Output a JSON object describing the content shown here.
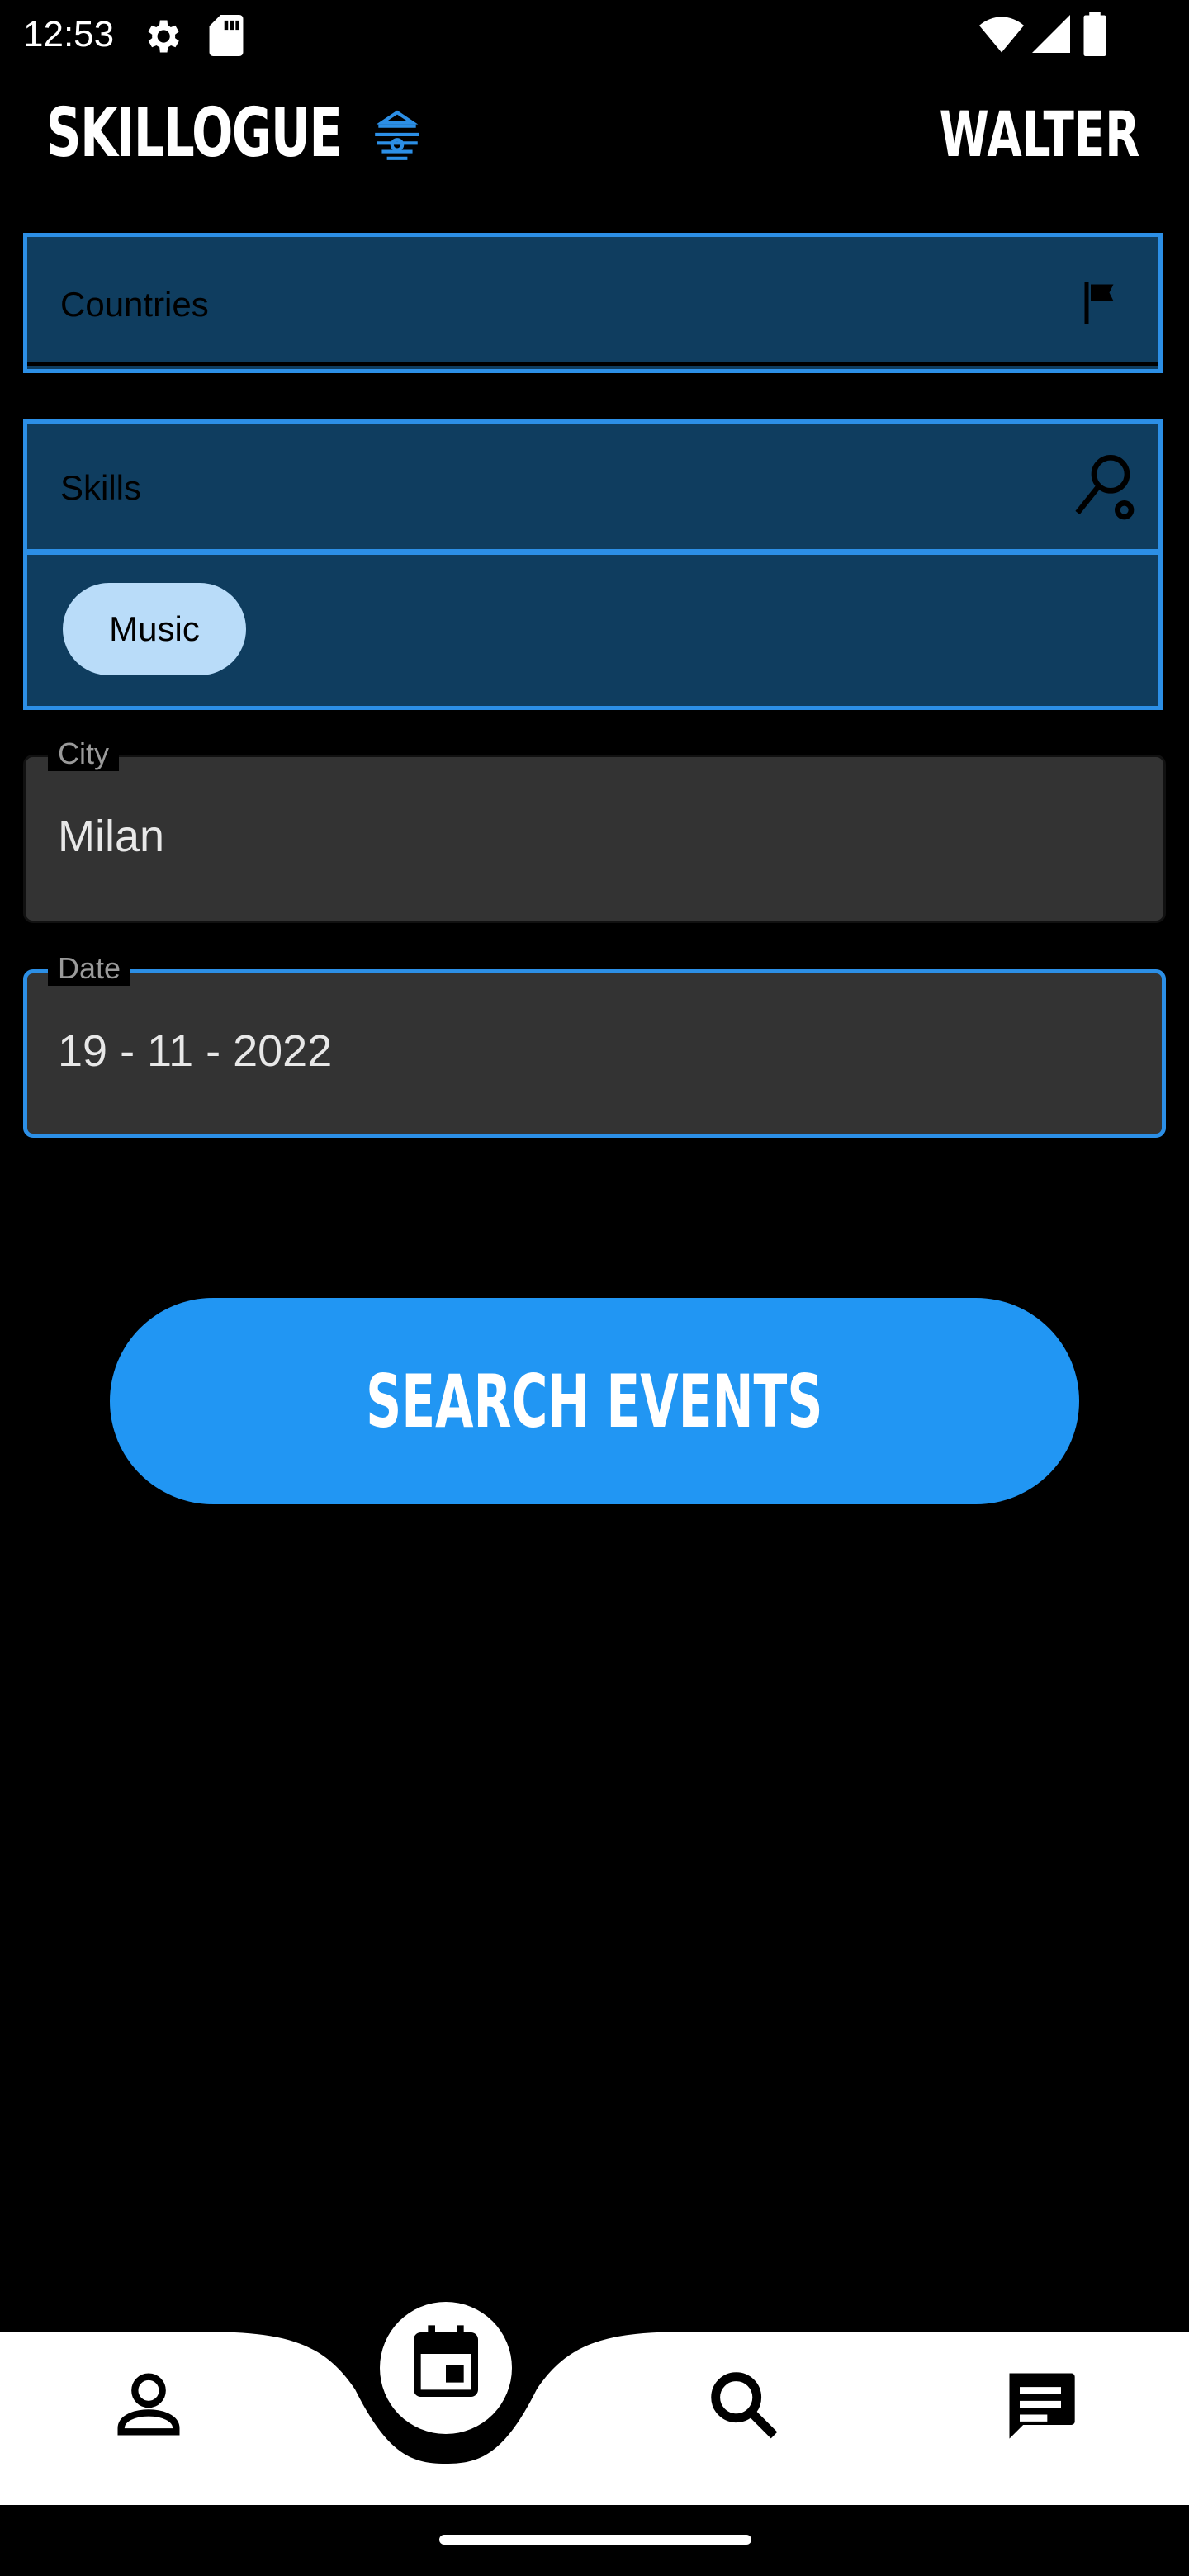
{
  "status_bar": {
    "time": "12:53",
    "icons": [
      "settings-icon",
      "sd-card-icon",
      "wifi-icon",
      "signal-icon",
      "battery-icon"
    ]
  },
  "header": {
    "app_title": "SKILLOGUE",
    "logo_icon": "beehive-icon",
    "user_name": "WALTER"
  },
  "filters": {
    "countries_label": "Countries",
    "countries_icon": "flag-icon",
    "skills_label": "Skills",
    "skills_icon": "key-search-icon",
    "skill_chips": [
      "Music"
    ]
  },
  "fields": {
    "city_label": "City",
    "city_value": "Milan",
    "date_label": "Date",
    "date_value": "19 - 11 - 2022"
  },
  "actions": {
    "search_label": "SEARCH EVENTS"
  },
  "bottom_nav": {
    "items": [
      "profile-icon",
      "calendar-icon",
      "search-icon",
      "chat-icon"
    ],
    "active": "calendar-icon"
  },
  "colors": {
    "accent": "#2196f3",
    "box_fill": "#0f3d5f",
    "box_border": "#2c8fe6",
    "chip": "#b9dcf9",
    "field_fill": "#333333"
  }
}
